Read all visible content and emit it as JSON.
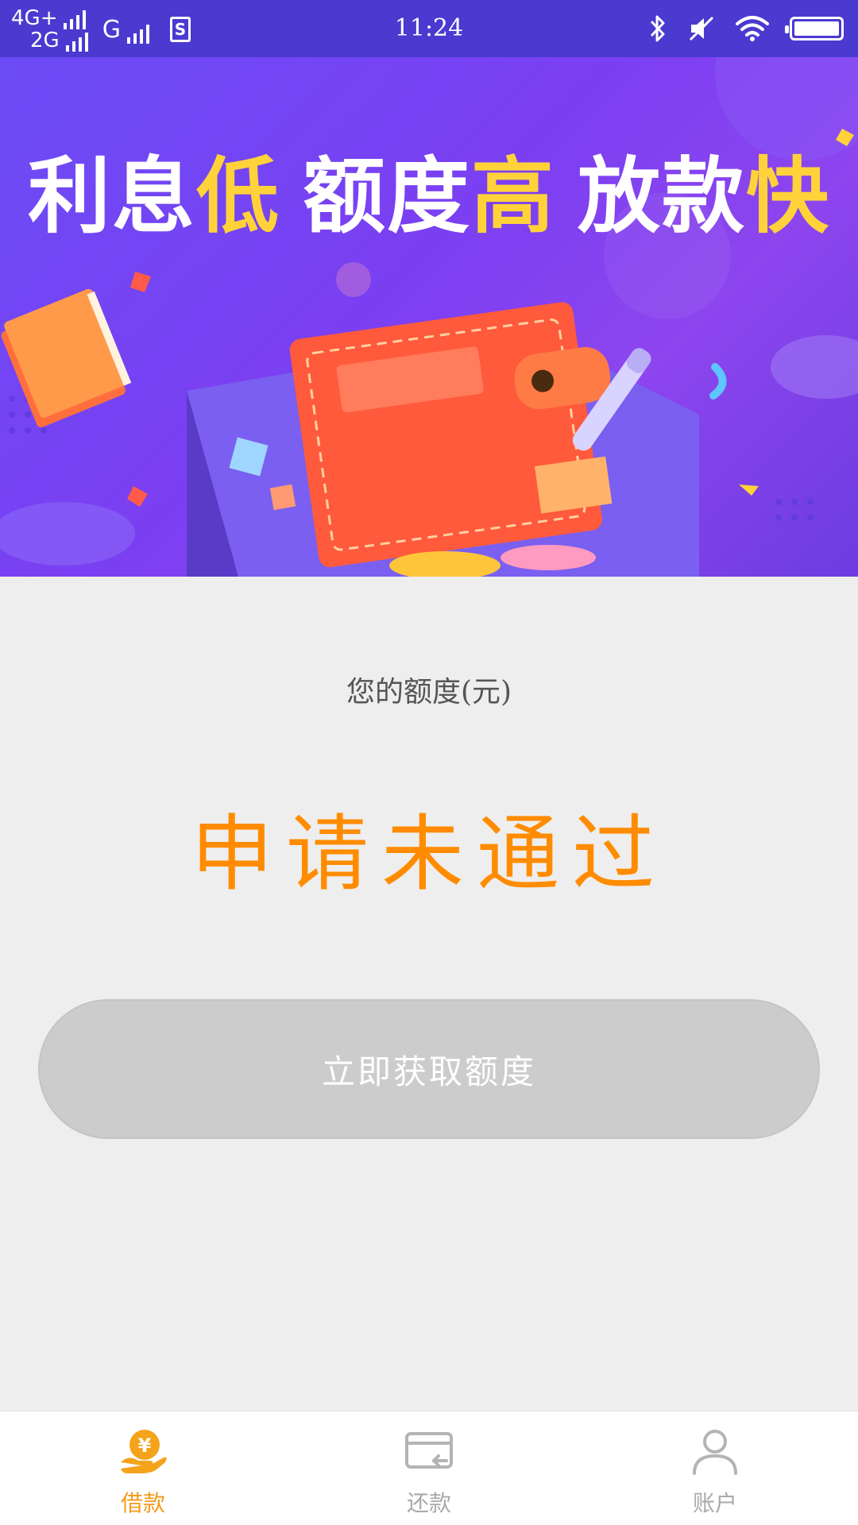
{
  "status_bar": {
    "network_top": "4G+",
    "network_bottom": "2G",
    "network_g": "G",
    "sim_badge": "S",
    "time": "11:24",
    "icons": [
      "bluetooth-icon",
      "mute-icon",
      "wifi-icon",
      "battery-icon"
    ]
  },
  "banner": {
    "slogan_part1": "利息",
    "slogan_hl1": "低",
    "slogan_part2": "额度",
    "slogan_hl2": "高",
    "slogan_part3": "放款",
    "slogan_hl3": "快"
  },
  "quota": {
    "label": "您的额度(元)",
    "status": "申请未通过"
  },
  "actions": {
    "get_quota_label": "立即获取额度"
  },
  "bottom_nav": {
    "items": [
      {
        "label": "借款",
        "icon": "loan-icon",
        "active": true
      },
      {
        "label": "还款",
        "icon": "repay-card-icon",
        "active": false
      },
      {
        "label": "账户",
        "icon": "account-icon",
        "active": false
      }
    ]
  },
  "colors": {
    "accent": "#ff8c00",
    "nav_active": "#f39a1a",
    "nav_inactive": "#a9a9a9",
    "button_disabled": "#cccccc",
    "status_bar_bg": "#4a3ad0"
  }
}
